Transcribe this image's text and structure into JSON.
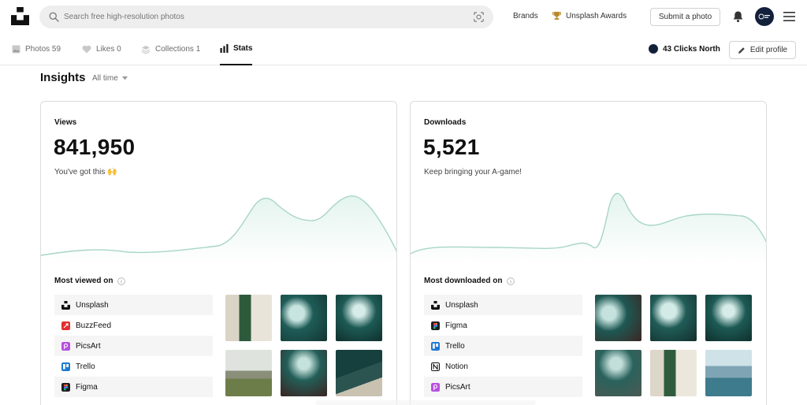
{
  "header": {
    "search_placeholder": "Search free high-resolution photos",
    "nav": {
      "brands": "Brands",
      "awards": "Unsplash Awards"
    },
    "submit_label": "Submit a photo"
  },
  "tabs": [
    {
      "label": "Photos 59",
      "icon": "image-icon"
    },
    {
      "label": "Likes 0",
      "icon": "heart-icon"
    },
    {
      "label": "Collections 1",
      "icon": "layers-icon"
    },
    {
      "label": "Stats",
      "icon": "bar-chart-icon",
      "active": true
    }
  ],
  "profile": {
    "name": "43 Clicks North",
    "edit_label": "Edit profile"
  },
  "insights": {
    "title": "Insights",
    "period": "All time"
  },
  "views": {
    "label": "Views",
    "value": "841,950",
    "subtitle": "You've got this 🙌",
    "section_title": "Most viewed on",
    "platforms": [
      {
        "name": "Unsplash",
        "icon": "unsplash-icon",
        "color": "#111111"
      },
      {
        "name": "BuzzFeed",
        "icon": "buzzfeed-icon",
        "color": "#e32d2d"
      },
      {
        "name": "PicsArt",
        "icon": "picsart-icon",
        "color": "#b84fe0"
      },
      {
        "name": "Trello",
        "icon": "trello-icon",
        "color": "#1d7ad4"
      },
      {
        "name": "Figma",
        "icon": "figma-icon",
        "color": "#1e1e1e"
      }
    ]
  },
  "downloads": {
    "label": "Downloads",
    "value": "5,521",
    "subtitle": "Keep bringing your A-game!",
    "section_title": "Most downloaded on",
    "platforms": [
      {
        "name": "Unsplash",
        "icon": "unsplash-icon",
        "color": "#111111"
      },
      {
        "name": "Figma",
        "icon": "figma-icon",
        "color": "#1e1e1e"
      },
      {
        "name": "Trello",
        "icon": "trello-icon",
        "color": "#1d7ad4"
      },
      {
        "name": "Notion",
        "icon": "notion-icon",
        "color": "#ffffff"
      },
      {
        "name": "PicsArt",
        "icon": "picsart-icon",
        "color": "#b84fe0"
      }
    ]
  },
  "colors": {
    "chart_line": "#a8d5c8",
    "chart_fill": "#eef8f4",
    "text_primary": "#111111",
    "text_secondary": "#767676"
  }
}
